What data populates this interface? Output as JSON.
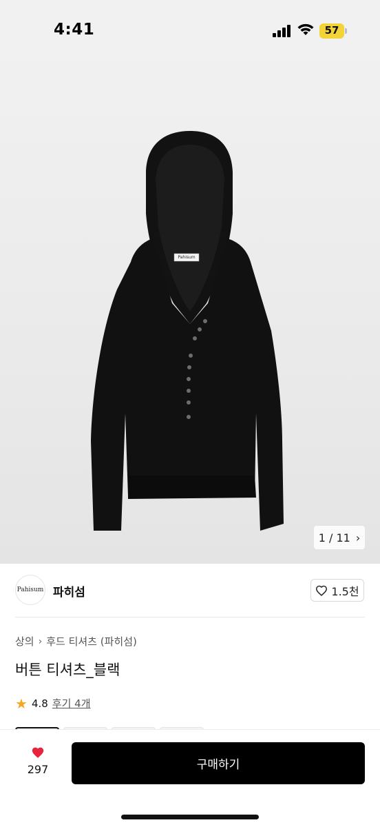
{
  "status_bar": {
    "time": "4:41",
    "battery": "57"
  },
  "hero": {
    "brand_tag": "Pahisum",
    "pager": "1 / 11"
  },
  "shop": {
    "logo_text": "Pahisum",
    "name": "파히섬",
    "likes": "1.5천"
  },
  "breadcrumb": {
    "items": [
      "상의",
      "후드 티셔츠 (파히섬)"
    ]
  },
  "product": {
    "title": "버튼 티셔츠_블랙",
    "rating": "4.8",
    "reviews": "후기 4개"
  },
  "bottom_bar": {
    "fav_count": "297",
    "buy_label": "구매하기"
  },
  "colors": {
    "accent": "#000000",
    "heart": "#e8243c",
    "star": "#f5a623",
    "battery": "#f2d436"
  },
  "icons": {
    "heart_outline": "heart-outline-icon",
    "heart_filled": "heart-filled-icon",
    "star": "star-icon",
    "chevron": "chevron-right-icon"
  }
}
